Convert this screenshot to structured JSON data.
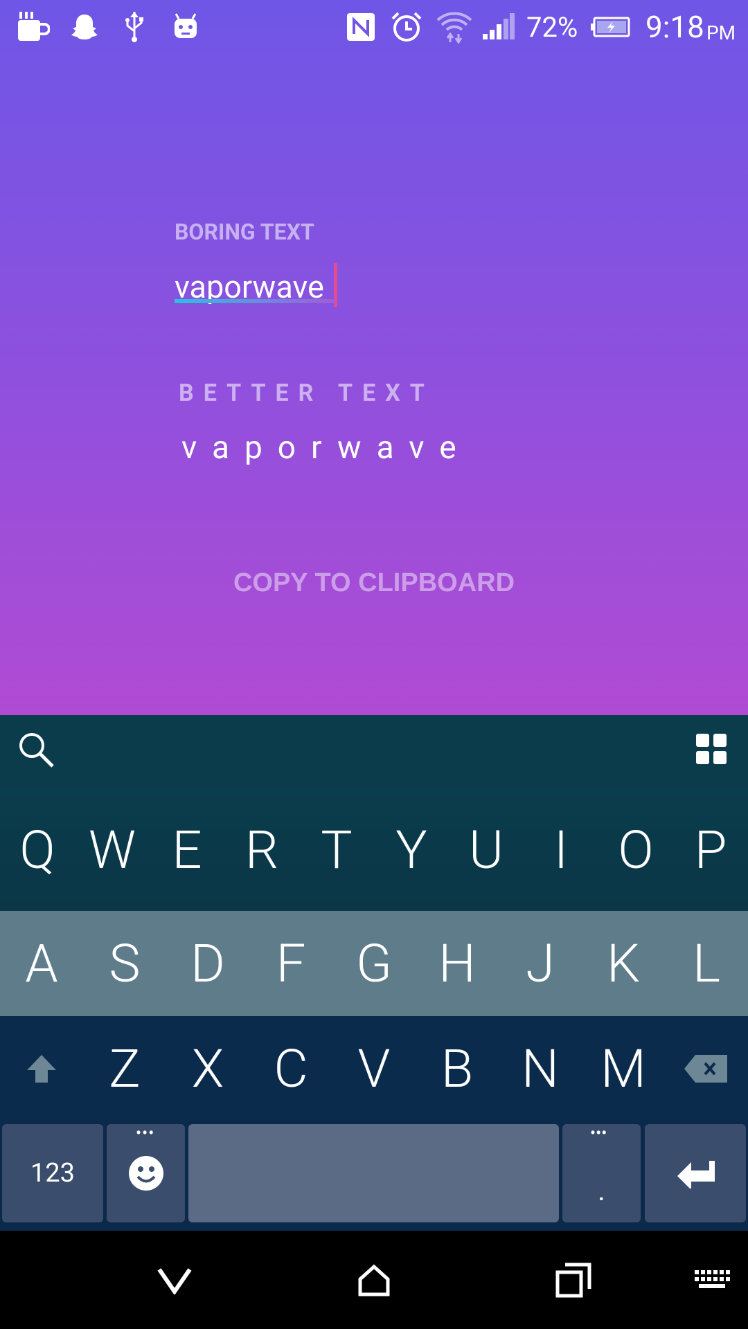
{
  "status_bar": {
    "battery": "72%",
    "time": "9:18",
    "ampm": "PM",
    "icons": [
      "coffee-cup-icon",
      "snapchat-ghost-icon",
      "usb-icon",
      "android-robot-icon",
      "nfc-icon",
      "alarm-clock-icon",
      "wifi-icon",
      "signal-icon",
      "battery-charging-icon"
    ]
  },
  "form": {
    "boring_label": "BORING TEXT",
    "boring_value": "vaporwave",
    "better_label": "BETTER TEXT",
    "better_value": "vaporwave",
    "copy_button": "COPY TO CLIPBOARD"
  },
  "keyboard": {
    "row1": [
      "Q",
      "W",
      "E",
      "R",
      "T",
      "Y",
      "U",
      "I",
      "O",
      "P"
    ],
    "row2": [
      "A",
      "S",
      "D",
      "F",
      "G",
      "H",
      "J",
      "K",
      "L"
    ],
    "row3": [
      "Z",
      "X",
      "C",
      "V",
      "B",
      "N",
      "M"
    ],
    "numbers_key": "123",
    "period_key": "."
  },
  "colors": {
    "gradient_top": "#6f56e6",
    "gradient_bottom": "#b04bd3",
    "keyboard_bg": "#0b3141",
    "cursor": "#e64a8f",
    "underline_start": "#29c2e0",
    "underline_end": "#a45bd8"
  }
}
